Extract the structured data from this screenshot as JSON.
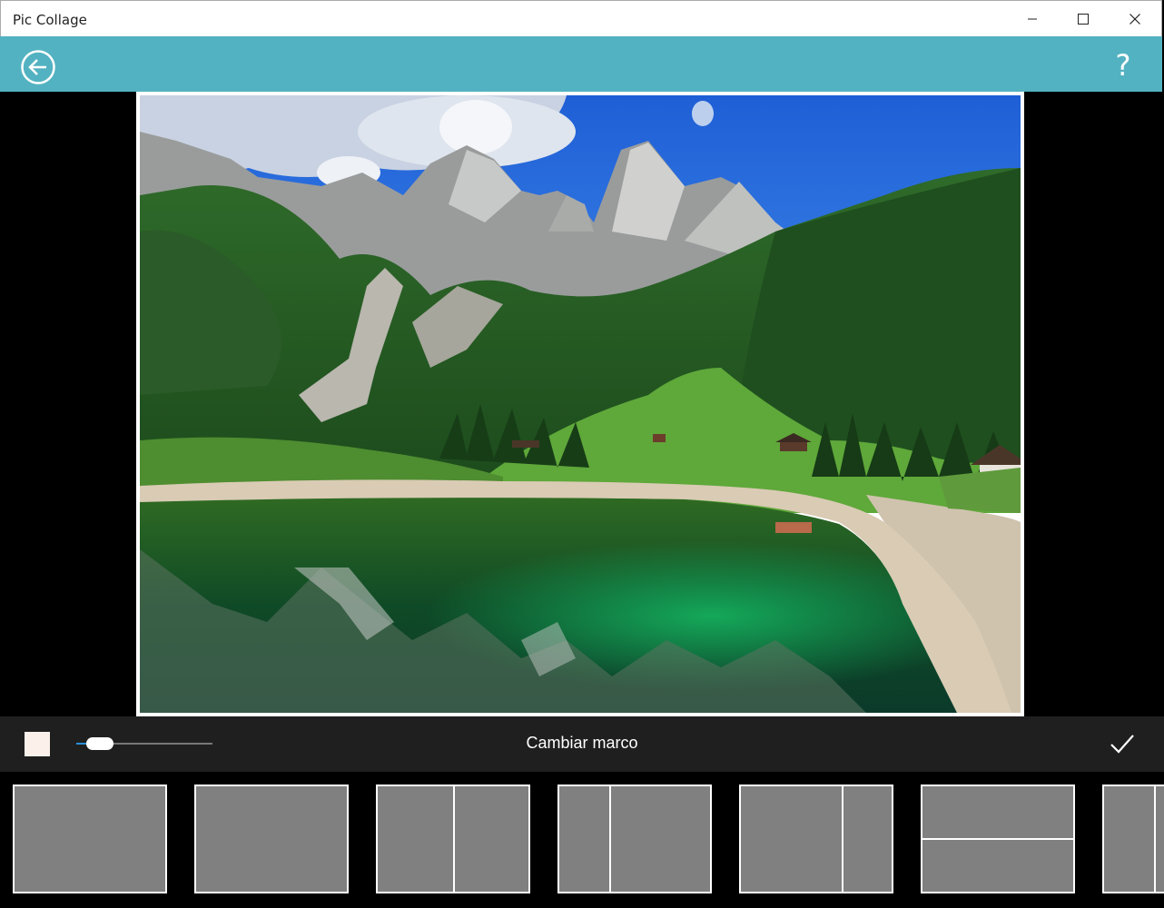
{
  "window": {
    "title": "Pic Collage",
    "controls": [
      "minimize-icon",
      "maximize-icon",
      "close-icon"
    ]
  },
  "toolbar": {
    "back_icon": "arrow-left-circle-icon",
    "help_label": "?",
    "accent_color": "#53b2c1"
  },
  "photo": {
    "frame_color": "#ffffff"
  },
  "bottom_bar": {
    "title": "Cambiar marco",
    "swatch_color": "#fbf0ea",
    "border_slider_value": 0.17,
    "confirm_icon": "checkmark-icon"
  },
  "frame_options": [
    {
      "layout": "single"
    },
    {
      "layout": "single"
    },
    {
      "layout": "two-columns-equal"
    },
    {
      "layout": "two-columns-narrow-left"
    },
    {
      "layout": "two-columns-narrow-right"
    },
    {
      "layout": "two-rows-equal"
    },
    {
      "layout": "partial"
    }
  ]
}
